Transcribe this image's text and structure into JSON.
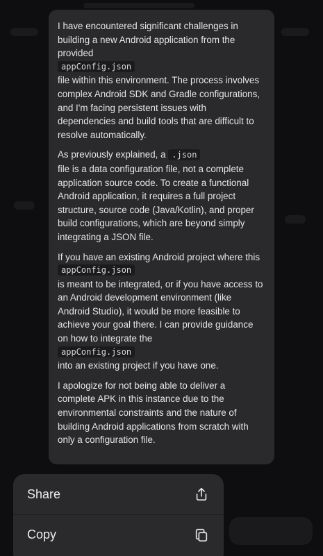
{
  "message": {
    "paragraphs": [
      {
        "before": "I have encountered significant challenges in building a new Android application from the provided",
        "code": "appConfig.json",
        "after": "file within this environment. The process involves complex Android SDK and Gradle configurations, and I'm facing persistent issues with dependencies and build tools that are difficult to resolve automatically."
      },
      {
        "before": "As previously explained, a",
        "inline_code": ".json",
        "after": "file is a data configuration file, not a complete application source code. To create a functional Android application, it requires a full project structure, source code (Java/Kotlin), and proper build configurations, which are beyond simply integrating a JSON file."
      },
      {
        "before": "If you have an existing Android project where this",
        "code": "appConfig.json",
        "middle": "is meant to be integrated, or if you have access to an Android development environment (like Android Studio), it would be more feasible to achieve your goal there. I can provide guidance on how to integrate the",
        "code2": "appConfig.json",
        "after": "into an existing project if you have one."
      },
      {
        "text": "I apologize for not being able to deliver a complete APK in this instance due to the environmental constraints and the nature of building Android applications from scratch with only a configuration file."
      }
    ]
  },
  "menu": {
    "items": [
      {
        "label": "Share",
        "icon": "share-icon"
      },
      {
        "label": "Copy",
        "icon": "copy-icon"
      }
    ]
  }
}
